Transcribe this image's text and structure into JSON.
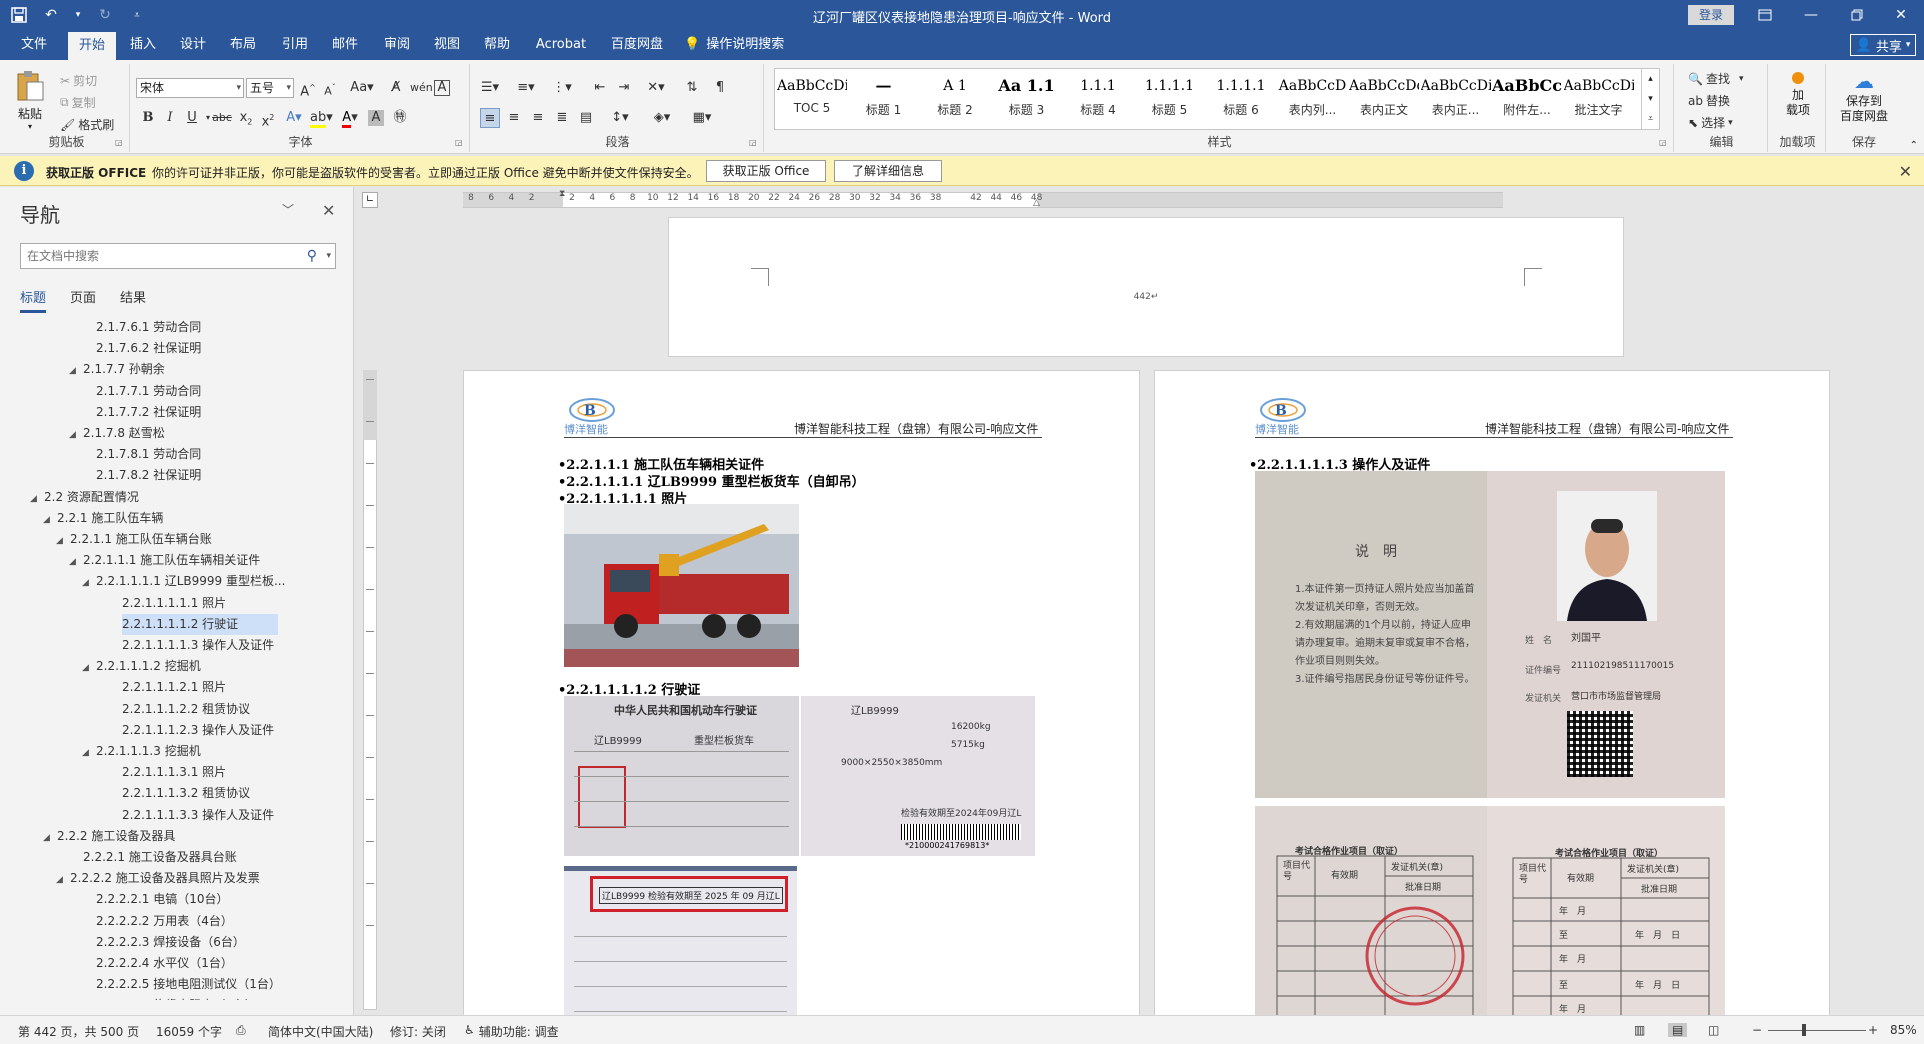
{
  "window": {
    "title": "辽河厂罐区仪表接地隐患治理项目-响应文件  -  Word",
    "login": "登录"
  },
  "menu": {
    "tabs": [
      "文件",
      "开始",
      "插入",
      "设计",
      "布局",
      "引用",
      "邮件",
      "审阅",
      "视图",
      "帮助",
      "Acrobat",
      "百度网盘"
    ],
    "tell_me": "操作说明搜索",
    "share": "共享",
    "active": "开始"
  },
  "ribbon": {
    "clipboard": {
      "paste": "粘贴",
      "cut": "剪切",
      "copy": "复制",
      "format_painter": "格式刷",
      "label": "剪贴板"
    },
    "font": {
      "name": "宋体",
      "size": "五号",
      "label": "字体"
    },
    "paragraph": {
      "label": "段落"
    },
    "styles": {
      "label": "样式",
      "items": [
        {
          "preview": "AaBbCcDi",
          "name": "TOC 5"
        },
        {
          "preview": "—",
          "name": "标题 1"
        },
        {
          "preview": "A 1",
          "name": "标题 2"
        },
        {
          "preview": "Aa 1.1",
          "name": "标题 3"
        },
        {
          "preview": "1.1.1",
          "name": "标题 4"
        },
        {
          "preview": "1.1.1.1",
          "name": "标题 5"
        },
        {
          "preview": "1.1.1.1",
          "name": "标题 6"
        },
        {
          "preview": "AaBbCcD",
          "name": "表内列..."
        },
        {
          "preview": "AaBbCcDd",
          "name": "表内正文"
        },
        {
          "preview": "AaBbCcDi",
          "name": "表内正..."
        },
        {
          "preview": "AaBbCc",
          "name": "附件左..."
        },
        {
          "preview": "AaBbCcDi",
          "name": "批注文字"
        }
      ]
    },
    "editing": {
      "find": "查找",
      "replace": "替换",
      "select": "选择",
      "label": "编辑"
    },
    "addin": {
      "button": "加\n载项",
      "label": "加载项"
    },
    "save": {
      "button": "保存到\n百度网盘",
      "label": "保存"
    }
  },
  "license": {
    "title": "获取正版 OFFICE",
    "message": "你的许可证并非正版，你可能是盗版软件的受害者。立即通过正版 Office 避免中断并使文件保持安全。",
    "btn_get": "获取正版 Office",
    "btn_more": "了解详细信息"
  },
  "nav": {
    "title": "导航",
    "search_placeholder": "在文档中搜索",
    "tabs": [
      "标题",
      "页面",
      "结果"
    ],
    "tree": [
      {
        "text": "2.1.7.6.1 劳动合同",
        "level": 6,
        "arrow": ""
      },
      {
        "text": "2.1.7.6.2 社保证明",
        "level": 6,
        "arrow": ""
      },
      {
        "text": "2.1.7.7 孙朝余",
        "level": 5,
        "arrow": "◢"
      },
      {
        "text": "2.1.7.7.1 劳动合同",
        "level": 6,
        "arrow": ""
      },
      {
        "text": "2.1.7.7.2 社保证明",
        "level": 6,
        "arrow": ""
      },
      {
        "text": "2.1.7.8 赵雪松",
        "level": 5,
        "arrow": "◢"
      },
      {
        "text": "2.1.7.8.1 劳动合同",
        "level": 6,
        "arrow": ""
      },
      {
        "text": "2.1.7.8.2 社保证明",
        "level": 6,
        "arrow": ""
      },
      {
        "text": "2.2 资源配置情况",
        "level": 2,
        "arrow": "◢"
      },
      {
        "text": "2.2.1 施工队伍车辆",
        "level": 3,
        "arrow": "◢"
      },
      {
        "text": "2.2.1.1 施工队伍车辆台账",
        "level": 4,
        "arrow": "◢"
      },
      {
        "text": "2.2.1.1.1 施工队伍车辆相关证件",
        "level": 5,
        "arrow": "◢"
      },
      {
        "text": "2.2.1.1.1.1 辽LB9999 重型栏板...",
        "level": 6,
        "arrow": "◢"
      },
      {
        "text": "2.2.1.1.1.1.1 照片",
        "level": 8,
        "arrow": ""
      },
      {
        "text": "2.2.1.1.1.1.2 行驶证",
        "level": 8,
        "arrow": "",
        "selected": true
      },
      {
        "text": "2.2.1.1.1.1.3 操作人及证件",
        "level": 8,
        "arrow": ""
      },
      {
        "text": "2.2.1.1.1.2 挖掘机",
        "level": 6,
        "arrow": "◢"
      },
      {
        "text": "2.2.1.1.1.2.1 照片",
        "level": 8,
        "arrow": ""
      },
      {
        "text": "2.2.1.1.1.2.2 租赁协议",
        "level": 8,
        "arrow": ""
      },
      {
        "text": "2.2.1.1.1.2.3 操作人及证件",
        "level": 8,
        "arrow": ""
      },
      {
        "text": "2.2.1.1.1.3 挖掘机",
        "level": 6,
        "arrow": "◢"
      },
      {
        "text": "2.2.1.1.1.3.1 照片",
        "level": 8,
        "arrow": ""
      },
      {
        "text": "2.2.1.1.1.3.2 租赁协议",
        "level": 8,
        "arrow": ""
      },
      {
        "text": "2.2.1.1.1.3.3 操作人及证件",
        "level": 8,
        "arrow": ""
      },
      {
        "text": "2.2.2 施工设备及器具",
        "level": 3,
        "arrow": "◢"
      },
      {
        "text": "2.2.2.1 施工设备及器具台账",
        "level": 5,
        "arrow": ""
      },
      {
        "text": "2.2.2.2 施工设备及器具照片及发票",
        "level": 4,
        "arrow": "◢"
      },
      {
        "text": "2.2.2.2.1 电镐（10台）",
        "level": 6,
        "arrow": ""
      },
      {
        "text": "2.2.2.2.2 万用表（4台）",
        "level": 6,
        "arrow": ""
      },
      {
        "text": "2.2.2.2.3 焊接设备（6台）",
        "level": 6,
        "arrow": ""
      },
      {
        "text": "2.2.2.2.4 水平仪（1台）",
        "level": 6,
        "arrow": ""
      },
      {
        "text": "2.2.2.2.5 接地电阻测试仪（1台）",
        "level": 6,
        "arrow": ""
      },
      {
        "text": "2.2.2.2.6 绝缘电阻表（1台）",
        "level": 6,
        "arrow": ""
      }
    ]
  },
  "ruler": {
    "numbers": [
      "8",
      "6",
      "4",
      "2",
      "",
      "2",
      "4",
      "6",
      "8",
      "10",
      "12",
      "14",
      "16",
      "18",
      "20",
      "22",
      "24",
      "26",
      "28",
      "30",
      "32",
      "34",
      "36",
      "38",
      "",
      "42",
      "44",
      "46",
      "48"
    ]
  },
  "document": {
    "page_number": "442",
    "header_text": "博洋智能科技工程（盘锦）有限公司-响应文件",
    "logo_text": "博洋智能",
    "left_page": {
      "h1": "•2.2.1.1.1 施工队伍车辆相关证件",
      "h2": "•2.2.1.1.1.1   辽LB9999 重型栏板货车（自卸吊）",
      "h3": "•2.2.1.1.1.1.1 照片",
      "h4": "•2.2.1.1.1.1.2 行驶证",
      "license_title": "中华人民共和国机动车行驶证",
      "plate": "辽LB9999",
      "vehicle_type": "重型栏板货车",
      "weight1": "16200kg",
      "weight2": "5715kg",
      "dims": "9000×2550×3850mm",
      "inspection": "检验有效期至2024年09月辽L",
      "barcode_num": "*210000241769813*",
      "stamp_text": "辽LB9999 检验有效期至 2025 年 09 月辽L"
    },
    "right_page": {
      "h1": "•2.2.1.1.1.1.3 操作人及证件",
      "cert_title": "说　明",
      "cert_text": "1.本证件第一页持证人照片处应当加盖首次发证机关印章，否则无效。\n2.有效期届满的1个月以前，持证人应申请办理复审。逾期未复审或复审不合格，作业项目则则失效。\n3.证件编号指居民身份证号等份证件号。",
      "name_label": "姓　名",
      "name": "刘国平",
      "idno_label": "证件编号",
      "idno": "211102198511170015",
      "issuer_label": "发证机关",
      "issuer": "营口市市场监督管理局",
      "table_title": "考试合格作业项目（取证）",
      "col1": "项目代号",
      "col2": "有效期",
      "col3": "发证机关(章)",
      "col4": "批准日期",
      "ymd": [
        "年",
        "月",
        "日"
      ],
      "zhi": "至"
    }
  },
  "status": {
    "page": "第 442 页，共 500 页",
    "words": "16059 个字",
    "lang": "简体中文(中国大陆)",
    "track": "修订: 关闭",
    "access": "辅助功能: 调查",
    "zoom": "85%"
  }
}
